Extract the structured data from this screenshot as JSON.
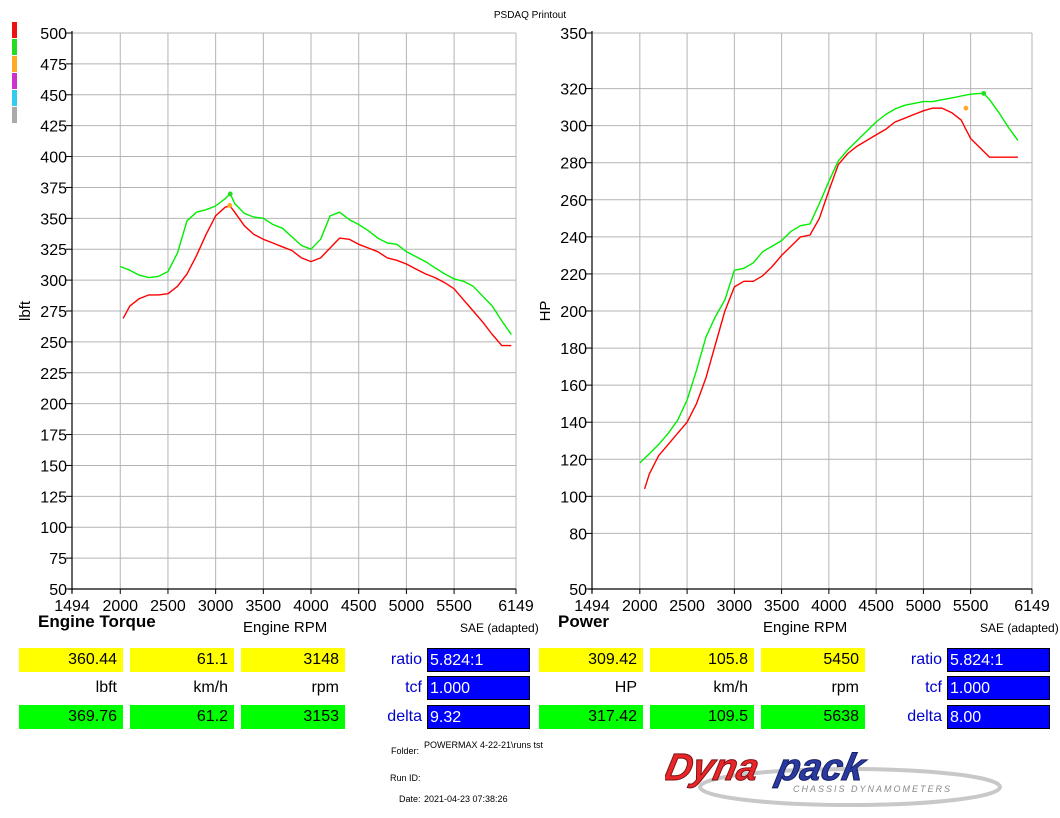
{
  "title": "PSDAQ Printout",
  "legend_colors": [
    "#ee1111",
    "#22dd22",
    "#ffaa22",
    "#cc33cc",
    "#33ccee",
    "#aaaaaa"
  ],
  "chart_data": [
    {
      "type": "line",
      "title": "Engine Torque",
      "xlabel": "Engine RPM",
      "ylabel": "lbft",
      "note": "SAE (adapted)",
      "xlim": [
        1494,
        6149
      ],
      "ylim": [
        50,
        500
      ],
      "xticks": [
        "1494",
        "2000",
        "2500",
        "3000",
        "3500",
        "4000",
        "4500",
        "5000",
        "5500",
        "6149"
      ],
      "yticks": [
        "50",
        "75",
        "100",
        "125",
        "150",
        "175",
        "200",
        "225",
        "250",
        "275",
        "300",
        "325",
        "350",
        "375",
        "400",
        "425",
        "450",
        "475",
        "500"
      ],
      "grid": true,
      "series": [
        {
          "color": "#ff0000",
          "x": [
            2030,
            2100,
            2200,
            2300,
            2400,
            2500,
            2600,
            2700,
            2800,
            2900,
            3000,
            3100,
            3150,
            3200,
            3300,
            3400,
            3500,
            3600,
            3700,
            3800,
            3900,
            4000,
            4100,
            4200,
            4300,
            4400,
            4500,
            4600,
            4700,
            4800,
            4900,
            5000,
            5100,
            5200,
            5300,
            5400,
            5500,
            5600,
            5700,
            5800,
            5900,
            6000,
            6100
          ],
          "y": [
            269,
            279,
            285,
            288,
            288,
            289,
            295,
            305,
            320,
            337,
            352,
            359,
            360,
            355,
            344,
            337,
            333,
            330,
            327,
            324,
            318,
            315,
            318,
            326,
            334,
            333,
            329,
            326,
            323,
            318,
            316,
            313,
            309,
            305,
            302,
            298,
            293,
            284,
            275,
            266,
            256,
            247,
            247
          ]
        },
        {
          "color": "#00ee00",
          "x": [
            2000,
            2100,
            2200,
            2300,
            2400,
            2500,
            2600,
            2700,
            2800,
            2900,
            3000,
            3100,
            3153,
            3200,
            3300,
            3400,
            3500,
            3600,
            3700,
            3800,
            3900,
            4000,
            4100,
            4200,
            4300,
            4400,
            4500,
            4600,
            4700,
            4800,
            4900,
            5000,
            5100,
            5200,
            5300,
            5400,
            5500,
            5600,
            5700,
            5800,
            5900,
            6000,
            6100
          ],
          "y": [
            311,
            308,
            304,
            302,
            303,
            307,
            322,
            348,
            355,
            357,
            360,
            366,
            370,
            362,
            354,
            351,
            350,
            345,
            342,
            335,
            328,
            325,
            333,
            352,
            355,
            349,
            345,
            340,
            334,
            330,
            329,
            323,
            319,
            315,
            310,
            305,
            301,
            299,
            295,
            287,
            279,
            267,
            256
          ]
        }
      ],
      "markers": [
        {
          "color": "#ffaa22",
          "x": 3148,
          "y": 360.44
        },
        {
          "color": "#22dd22",
          "x": 3153,
          "y": 369.76
        }
      ]
    },
    {
      "type": "line",
      "title": "Power",
      "xlabel": "Engine RPM",
      "ylabel": "HP",
      "note": "SAE (adapted)",
      "xlim": [
        1494,
        6149
      ],
      "ylim": [
        50,
        350
      ],
      "xticks": [
        "1494",
        "2000",
        "2500",
        "3000",
        "3500",
        "4000",
        "4500",
        "5000",
        "5500",
        "6149"
      ],
      "yticks": [
        "50",
        "80",
        "100",
        "120",
        "140",
        "160",
        "180",
        "200",
        "220",
        "240",
        "260",
        "280",
        "300",
        "320",
        "350"
      ],
      "grid": true,
      "series": [
        {
          "color": "#ff0000",
          "x": [
            2050,
            2100,
            2200,
            2300,
            2400,
            2500,
            2600,
            2700,
            2800,
            2900,
            3000,
            3100,
            3200,
            3300,
            3400,
            3500,
            3600,
            3700,
            3800,
            3900,
            4000,
            4100,
            4200,
            4300,
            4400,
            4500,
            4600,
            4700,
            4800,
            4900,
            5000,
            5100,
            5200,
            5300,
            5400,
            5450,
            5500,
            5600,
            5700,
            5800,
            5900,
            6000
          ],
          "y": [
            104,
            112,
            122,
            128,
            134,
            140,
            150,
            164,
            182,
            200,
            213,
            216,
            216,
            219,
            224,
            230,
            235,
            240,
            241,
            250,
            265,
            279,
            285,
            289,
            292,
            295,
            298,
            302,
            304,
            306,
            308,
            309.5,
            309.4,
            307,
            303,
            298,
            293,
            288,
            283,
            283,
            283,
            283
          ]
        },
        {
          "color": "#00ee00",
          "x": [
            2000,
            2100,
            2200,
            2300,
            2400,
            2500,
            2600,
            2700,
            2800,
            2900,
            3000,
            3100,
            3200,
            3300,
            3400,
            3500,
            3600,
            3700,
            3800,
            3900,
            4000,
            4100,
            4200,
            4300,
            4400,
            4500,
            4600,
            4700,
            4800,
            4900,
            5000,
            5100,
            5200,
            5300,
            5400,
            5500,
            5600,
            5638,
            5700,
            5800,
            5900,
            6000
          ],
          "y": [
            118,
            123,
            128,
            134,
            141,
            152,
            168,
            186,
            197,
            206,
            222,
            223,
            226,
            232,
            235,
            238,
            243,
            246,
            247,
            258,
            270,
            281,
            287,
            292,
            297,
            302,
            306,
            309,
            311,
            312,
            313,
            313,
            314,
            315,
            316,
            317,
            317.4,
            317.4,
            314,
            307,
            299,
            292
          ]
        }
      ],
      "markers": [
        {
          "color": "#ffaa22",
          "x": 5450,
          "y": 309.42
        },
        {
          "color": "#22dd22",
          "x": 5638,
          "y": 317.42
        }
      ]
    }
  ],
  "torque_panel": {
    "row1": [
      "360.44",
      "61.1",
      "3148"
    ],
    "row2": [
      "lbft",
      "km/h",
      "rpm"
    ],
    "row3": [
      "369.76",
      "61.2",
      "3153"
    ],
    "ratio_label": "ratio",
    "ratio_value": "5.824:1",
    "tcf_label": "tcf",
    "tcf_value": "1.000",
    "delta_label": "delta",
    "delta_value": "9.32"
  },
  "power_panel": {
    "row1": [
      "309.42",
      "105.8",
      "5450"
    ],
    "row2": [
      "HP",
      "km/h",
      "rpm"
    ],
    "row3": [
      "317.42",
      "109.5",
      "5638"
    ],
    "ratio_label": "ratio",
    "ratio_value": "5.824:1",
    "tcf_label": "tcf",
    "tcf_value": "1.000",
    "delta_label": "delta",
    "delta_value": "8.00"
  },
  "footer": {
    "folder_label": "Folder:",
    "folder_value": "POWERMAX 4-22-21\\runs tst",
    "runid_label": "Run ID:",
    "runid_value": "",
    "date_label": "Date:",
    "date_value": "2021-04-23 07:38:26"
  },
  "logo": {
    "brand": "Dynapack",
    "tagline": "CHASSIS DYNAMOMETERS"
  }
}
